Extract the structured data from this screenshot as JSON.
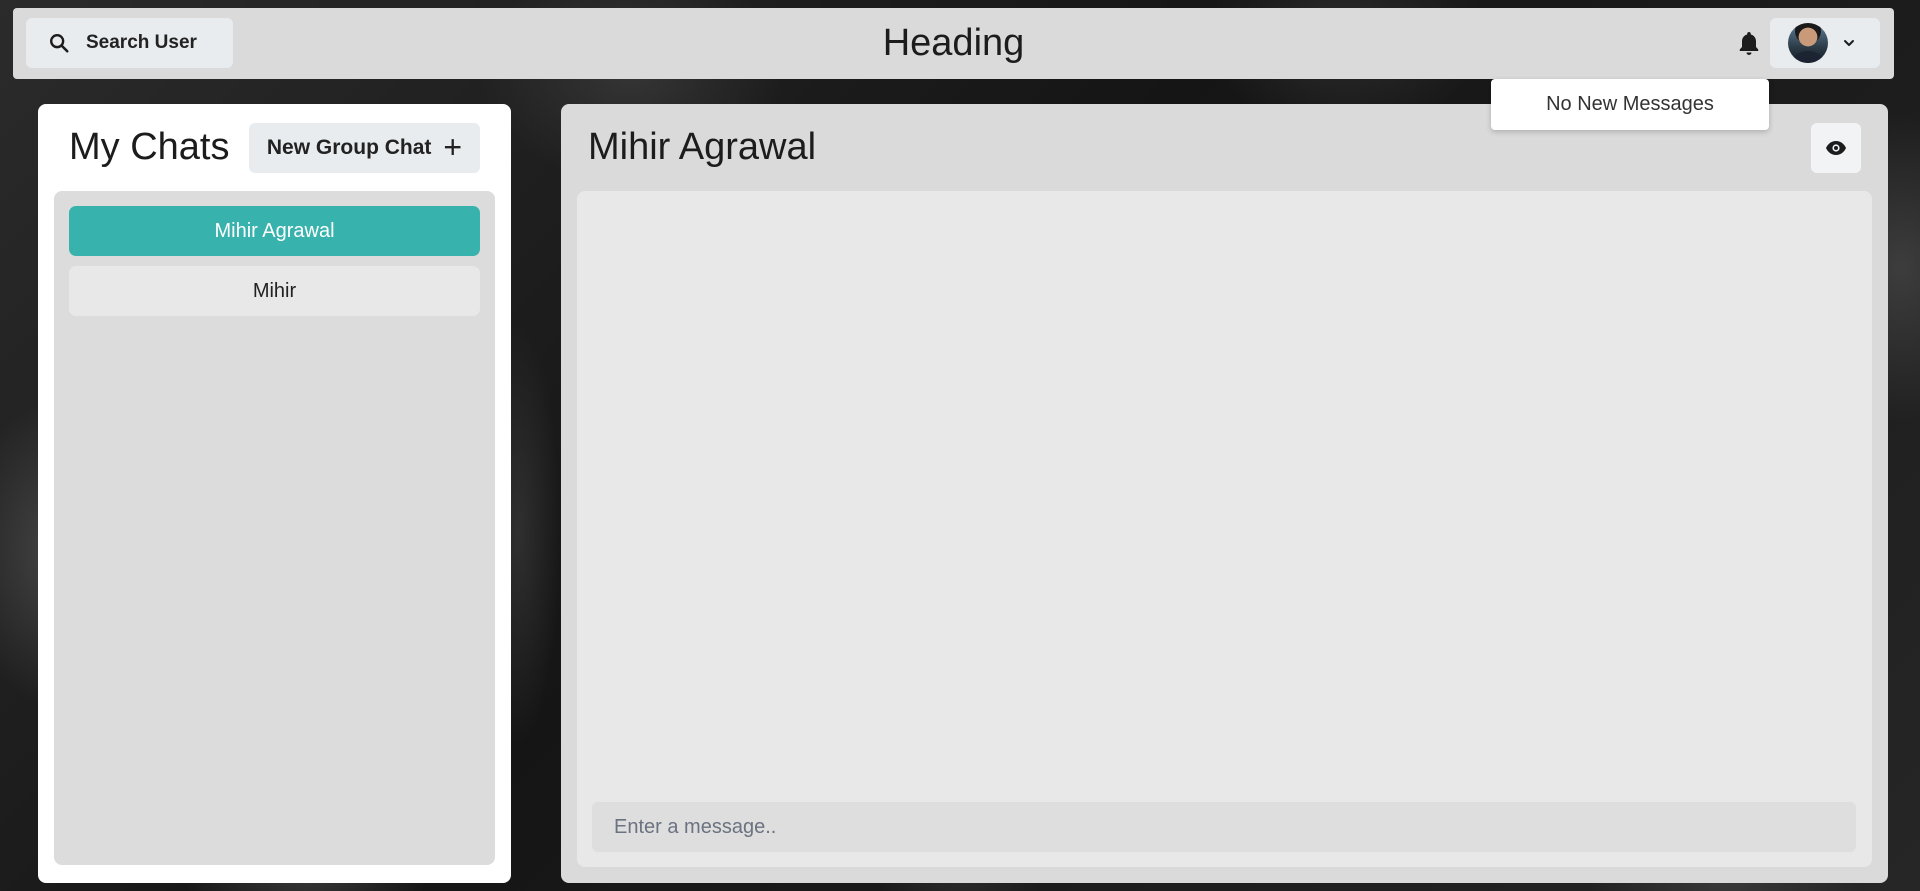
{
  "header": {
    "search_label": "Search User",
    "title": "Heading",
    "icons": {
      "search": "search-icon",
      "bell": "bell-icon",
      "profile_menu": "chevron-down-icon"
    }
  },
  "notifications": {
    "dropdown_text": "No New Messages"
  },
  "sidebar": {
    "title": "My Chats",
    "new_group_label": "New Group Chat",
    "new_group_icon": "+",
    "chats": [
      {
        "label": "Mihir Agrawal",
        "selected": true
      },
      {
        "label": "Mihir",
        "selected": false
      }
    ]
  },
  "chat": {
    "title": "Mihir Agrawal",
    "view_icon": "eye-icon",
    "input_placeholder": "Enter a message.."
  },
  "colors": {
    "accent": "#38b2ac",
    "panel": "#dadada",
    "button": "#e8ecef"
  }
}
